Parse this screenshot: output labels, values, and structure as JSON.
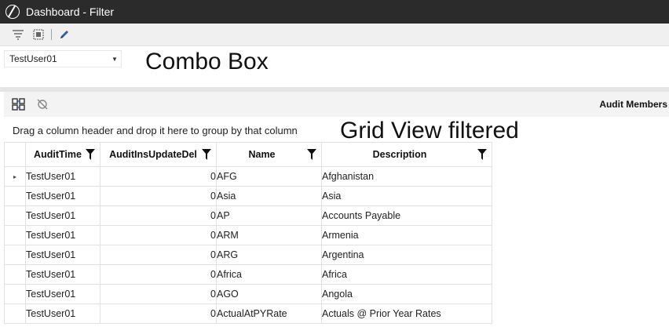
{
  "window": {
    "title": "Dashboard - Filter"
  },
  "toolbar": {
    "icons": [
      "filter-icon",
      "select-all-icon",
      "edit-icon"
    ]
  },
  "combo": {
    "value": "TestUser01"
  },
  "annotations": {
    "combo_label": "Combo Box",
    "grid_label": "Grid View filtered"
  },
  "grid": {
    "title": "Audit Members",
    "group_hint": "Drag a column header and drop it here to group by that column",
    "columns": [
      "AuditTime",
      "AuditInsUpdateDel",
      "Name",
      "Description"
    ],
    "rows": [
      {
        "audit_time": "TestUser01",
        "audit_ins": "0",
        "name": "AFG",
        "description": "Afghanistan"
      },
      {
        "audit_time": "TestUser01",
        "audit_ins": "0",
        "name": "Asia",
        "description": "Asia"
      },
      {
        "audit_time": "TestUser01",
        "audit_ins": "0",
        "name": "AP",
        "description": "Accounts Payable"
      },
      {
        "audit_time": "TestUser01",
        "audit_ins": "0",
        "name": "ARM",
        "description": "Armenia"
      },
      {
        "audit_time": "TestUser01",
        "audit_ins": "0",
        "name": "ARG",
        "description": "Argentina"
      },
      {
        "audit_time": "TestUser01",
        "audit_ins": "0",
        "name": "Africa",
        "description": "Africa"
      },
      {
        "audit_time": "TestUser01",
        "audit_ins": "0",
        "name": "AGO",
        "description": "Angola"
      },
      {
        "audit_time": "TestUser01",
        "audit_ins": "0",
        "name": "ActualAtPYRate",
        "description": "Actuals @ Prior Year Rates"
      }
    ]
  },
  "colors": {
    "titlebar": "#2b2b2b",
    "toolbar": "#f0f0f0",
    "grid_border": "#e2e2e2"
  }
}
